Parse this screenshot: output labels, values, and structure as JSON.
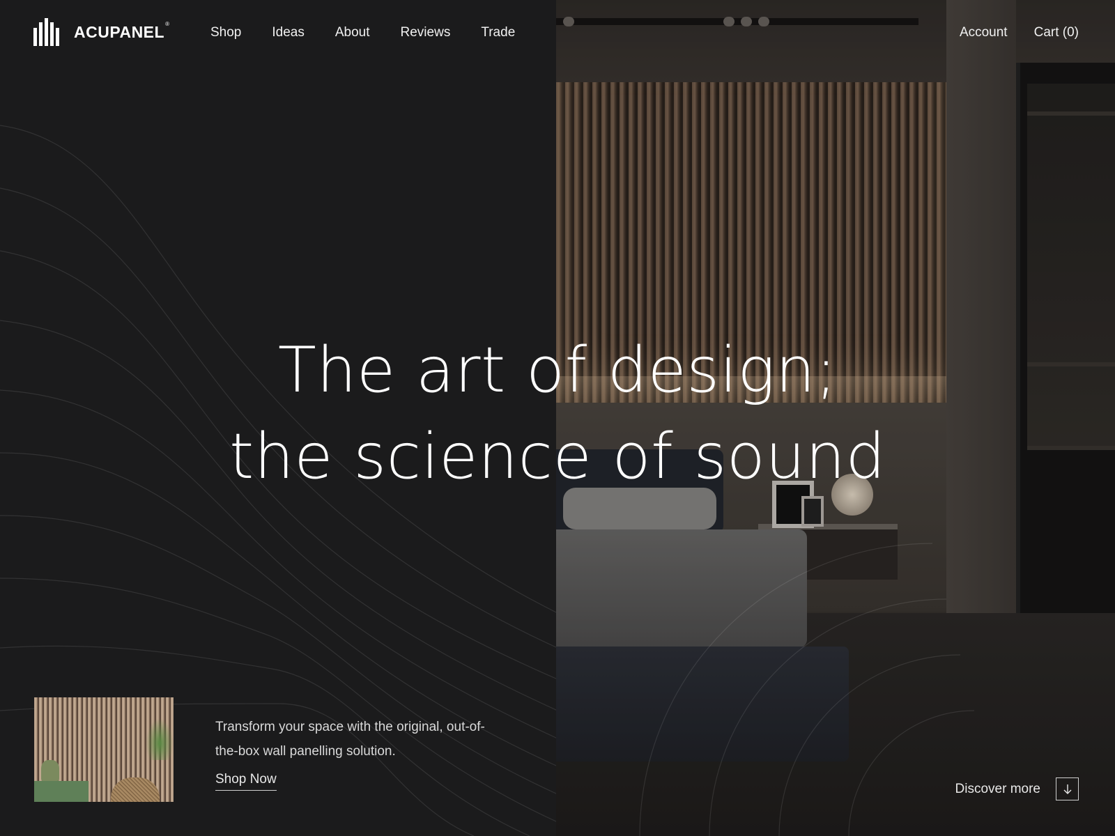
{
  "brand": {
    "name": "ACUPANEL",
    "registered": "®"
  },
  "nav": {
    "links": [
      {
        "label": "Shop"
      },
      {
        "label": "Ideas"
      },
      {
        "label": "About"
      },
      {
        "label": "Reviews"
      },
      {
        "label": "Trade"
      }
    ],
    "account_label": "Account",
    "cart_label": "Cart (0)"
  },
  "hero": {
    "line1": "The art of design;",
    "line2": "the science of sound"
  },
  "promo": {
    "text": "Transform your space with the original, out-of-the-box wall panelling solution.",
    "cta_label": "Shop Now"
  },
  "discover": {
    "label": "Discover more",
    "icon": "arrow-down-icon"
  },
  "colors": {
    "background": "#1b1b1c",
    "text": "#ffffff",
    "muted_text": "#d9d9d9"
  }
}
